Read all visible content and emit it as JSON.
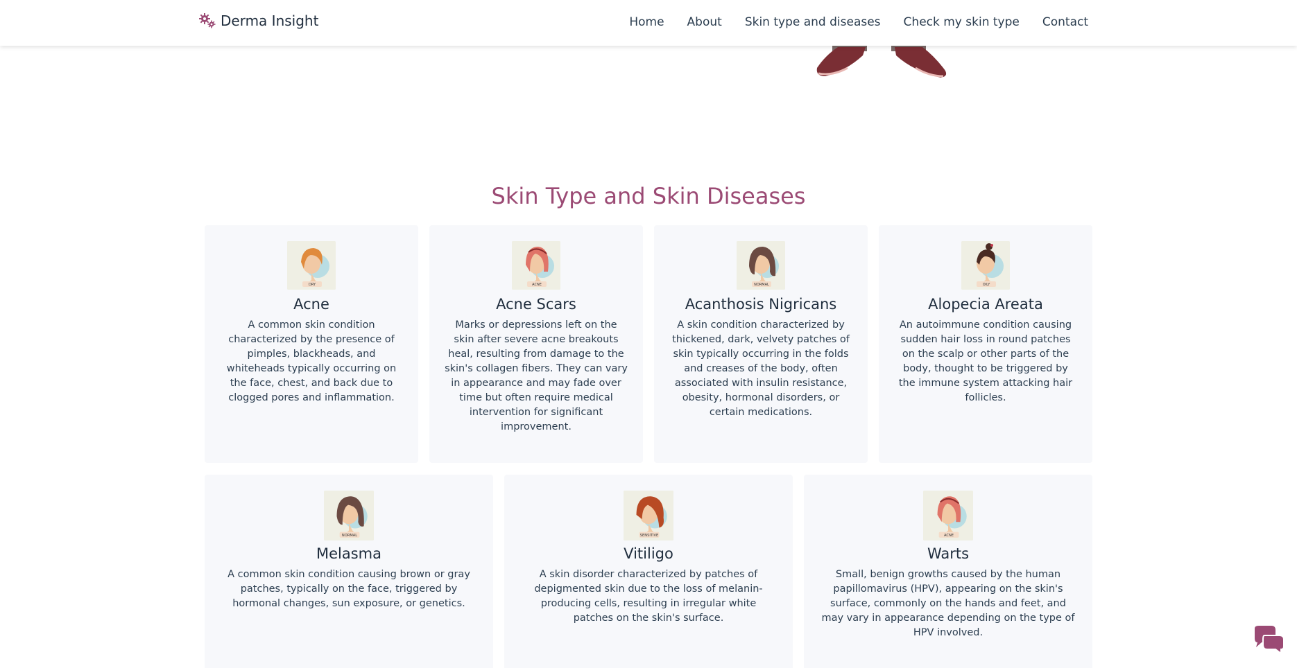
{
  "brand": {
    "name": "Derma Insight",
    "icon": "gears-icon",
    "color": "#9b4a74"
  },
  "nav": [
    {
      "label": "Home"
    },
    {
      "label": "About"
    },
    {
      "label": "Skin type and diseases"
    },
    {
      "label": "Check my skin type"
    },
    {
      "label": "Contact"
    }
  ],
  "section": {
    "title": "Skin Type and Skin Diseases"
  },
  "cards": [
    {
      "title": "Acne",
      "tag": "DRY",
      "text": "A common skin condition characterized by the presence of pimples, blackheads, and whiteheads typically occurring on the face, chest, and back due to clogged pores and inflammation."
    },
    {
      "title": "Acne Scars",
      "tag": "ACNE",
      "text": "Marks or depressions left on the skin after severe acne breakouts heal, resulting from damage to the skin's collagen fibers. They can vary in appearance and may fade over time but often require medical intervention for significant improvement."
    },
    {
      "title": "Acanthosis Nigricans",
      "tag": "NORMAL",
      "text": "A skin condition characterized by thickened, dark, velvety patches of skin typically occurring in the folds and creases of the body, often associated with insulin resistance, obesity, hormonal disorders, or certain medications."
    },
    {
      "title": "Alopecia Areata",
      "tag": "OILY",
      "text": "An autoimmune condition causing sudden hair loss in round patches on the scalp or other parts of the body, thought to be triggered by the immune system attacking hair follicles."
    },
    {
      "title": "Melasma",
      "tag": "NORMAL",
      "text": "A common skin condition causing brown or gray patches, typically on the face, triggered by hormonal changes, sun exposure, or genetics."
    },
    {
      "title": "Vitiligo",
      "tag": "SENSITIVE",
      "text": "A skin disorder characterized by patches of depigmented skin due to the loss of melanin-producing cells, resulting in irregular white patches on the skin's surface."
    },
    {
      "title": "Warts",
      "tag": "ACNE",
      "text": "Small, benign growths caused by the human papillomavirus (HPV), appearing on the skin's surface, commonly on the hands and feet, and may vary in appearance depending on the type of HPV involved."
    }
  ],
  "chat": {
    "icon": "chat-bubbles-icon",
    "color": "#9b4a74"
  }
}
